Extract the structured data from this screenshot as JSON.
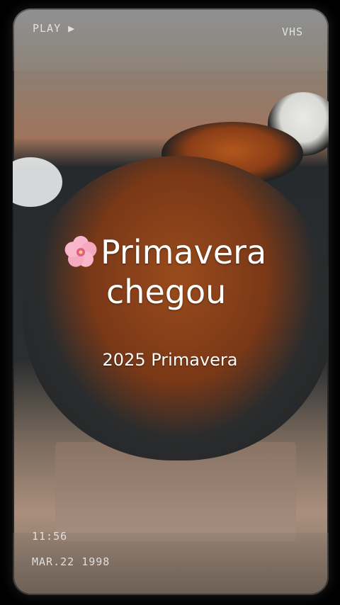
{
  "overlay": {
    "status_left": "PLAY ▶",
    "status_right": "VHS",
    "time": "11:56",
    "date": "MAR.22 1998"
  },
  "caption": {
    "title_line1": "Primavera",
    "title_line2": "chegou",
    "subtitle": "2025 Primavera",
    "emoji_icon": "cherry-blossom-icon"
  },
  "colors": {
    "text": "#ffffff",
    "broth": "#8b3e17",
    "pot": "#262a2c"
  }
}
